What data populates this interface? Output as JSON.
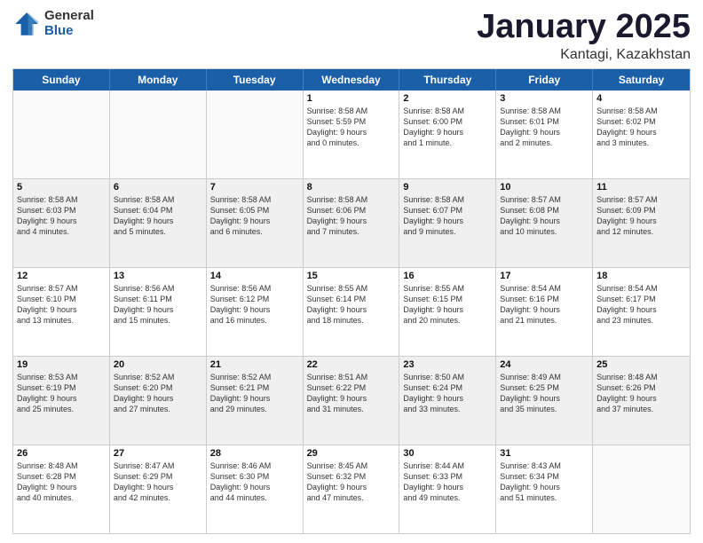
{
  "logo": {
    "general": "General",
    "blue": "Blue"
  },
  "header": {
    "title": "January 2025",
    "subtitle": "Kantagi, Kazakhstan"
  },
  "days_of_week": [
    "Sunday",
    "Monday",
    "Tuesday",
    "Wednesday",
    "Thursday",
    "Friday",
    "Saturday"
  ],
  "weeks": [
    [
      {
        "day": "",
        "detail": ""
      },
      {
        "day": "",
        "detail": ""
      },
      {
        "day": "",
        "detail": ""
      },
      {
        "day": "1",
        "detail": "Sunrise: 8:58 AM\nSunset: 5:59 PM\nDaylight: 9 hours\nand 0 minutes."
      },
      {
        "day": "2",
        "detail": "Sunrise: 8:58 AM\nSunset: 6:00 PM\nDaylight: 9 hours\nand 1 minute."
      },
      {
        "day": "3",
        "detail": "Sunrise: 8:58 AM\nSunset: 6:01 PM\nDaylight: 9 hours\nand 2 minutes."
      },
      {
        "day": "4",
        "detail": "Sunrise: 8:58 AM\nSunset: 6:02 PM\nDaylight: 9 hours\nand 3 minutes."
      }
    ],
    [
      {
        "day": "5",
        "detail": "Sunrise: 8:58 AM\nSunset: 6:03 PM\nDaylight: 9 hours\nand 4 minutes."
      },
      {
        "day": "6",
        "detail": "Sunrise: 8:58 AM\nSunset: 6:04 PM\nDaylight: 9 hours\nand 5 minutes."
      },
      {
        "day": "7",
        "detail": "Sunrise: 8:58 AM\nSunset: 6:05 PM\nDaylight: 9 hours\nand 6 minutes."
      },
      {
        "day": "8",
        "detail": "Sunrise: 8:58 AM\nSunset: 6:06 PM\nDaylight: 9 hours\nand 7 minutes."
      },
      {
        "day": "9",
        "detail": "Sunrise: 8:58 AM\nSunset: 6:07 PM\nDaylight: 9 hours\nand 9 minutes."
      },
      {
        "day": "10",
        "detail": "Sunrise: 8:57 AM\nSunset: 6:08 PM\nDaylight: 9 hours\nand 10 minutes."
      },
      {
        "day": "11",
        "detail": "Sunrise: 8:57 AM\nSunset: 6:09 PM\nDaylight: 9 hours\nand 12 minutes."
      }
    ],
    [
      {
        "day": "12",
        "detail": "Sunrise: 8:57 AM\nSunset: 6:10 PM\nDaylight: 9 hours\nand 13 minutes."
      },
      {
        "day": "13",
        "detail": "Sunrise: 8:56 AM\nSunset: 6:11 PM\nDaylight: 9 hours\nand 15 minutes."
      },
      {
        "day": "14",
        "detail": "Sunrise: 8:56 AM\nSunset: 6:12 PM\nDaylight: 9 hours\nand 16 minutes."
      },
      {
        "day": "15",
        "detail": "Sunrise: 8:55 AM\nSunset: 6:14 PM\nDaylight: 9 hours\nand 18 minutes."
      },
      {
        "day": "16",
        "detail": "Sunrise: 8:55 AM\nSunset: 6:15 PM\nDaylight: 9 hours\nand 20 minutes."
      },
      {
        "day": "17",
        "detail": "Sunrise: 8:54 AM\nSunset: 6:16 PM\nDaylight: 9 hours\nand 21 minutes."
      },
      {
        "day": "18",
        "detail": "Sunrise: 8:54 AM\nSunset: 6:17 PM\nDaylight: 9 hours\nand 23 minutes."
      }
    ],
    [
      {
        "day": "19",
        "detail": "Sunrise: 8:53 AM\nSunset: 6:19 PM\nDaylight: 9 hours\nand 25 minutes."
      },
      {
        "day": "20",
        "detail": "Sunrise: 8:52 AM\nSunset: 6:20 PM\nDaylight: 9 hours\nand 27 minutes."
      },
      {
        "day": "21",
        "detail": "Sunrise: 8:52 AM\nSunset: 6:21 PM\nDaylight: 9 hours\nand 29 minutes."
      },
      {
        "day": "22",
        "detail": "Sunrise: 8:51 AM\nSunset: 6:22 PM\nDaylight: 9 hours\nand 31 minutes."
      },
      {
        "day": "23",
        "detail": "Sunrise: 8:50 AM\nSunset: 6:24 PM\nDaylight: 9 hours\nand 33 minutes."
      },
      {
        "day": "24",
        "detail": "Sunrise: 8:49 AM\nSunset: 6:25 PM\nDaylight: 9 hours\nand 35 minutes."
      },
      {
        "day": "25",
        "detail": "Sunrise: 8:48 AM\nSunset: 6:26 PM\nDaylight: 9 hours\nand 37 minutes."
      }
    ],
    [
      {
        "day": "26",
        "detail": "Sunrise: 8:48 AM\nSunset: 6:28 PM\nDaylight: 9 hours\nand 40 minutes."
      },
      {
        "day": "27",
        "detail": "Sunrise: 8:47 AM\nSunset: 6:29 PM\nDaylight: 9 hours\nand 42 minutes."
      },
      {
        "day": "28",
        "detail": "Sunrise: 8:46 AM\nSunset: 6:30 PM\nDaylight: 9 hours\nand 44 minutes."
      },
      {
        "day": "29",
        "detail": "Sunrise: 8:45 AM\nSunset: 6:32 PM\nDaylight: 9 hours\nand 47 minutes."
      },
      {
        "day": "30",
        "detail": "Sunrise: 8:44 AM\nSunset: 6:33 PM\nDaylight: 9 hours\nand 49 minutes."
      },
      {
        "day": "31",
        "detail": "Sunrise: 8:43 AM\nSunset: 6:34 PM\nDaylight: 9 hours\nand 51 minutes."
      },
      {
        "day": "",
        "detail": ""
      }
    ]
  ]
}
